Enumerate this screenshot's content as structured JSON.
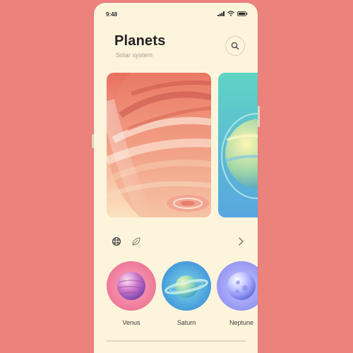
{
  "status": {
    "time": "9:48",
    "icons": [
      "signal-icon",
      "wifi-icon",
      "battery-icon"
    ]
  },
  "header": {
    "title": "Planets",
    "subtitle": "Solar system",
    "search_icon": "search-icon"
  },
  "filters": {
    "icons": [
      "planet-grid-icon",
      "leaf-icon"
    ],
    "next_icon": "chevron-right-icon"
  },
  "planets": [
    {
      "name": "Venus"
    },
    {
      "name": "Saturn"
    },
    {
      "name": "Neptune"
    }
  ],
  "colors": {
    "background": "#ec827c",
    "screen": "#fdf4dc",
    "title": "#222222",
    "subtitle": "#a59d90"
  }
}
